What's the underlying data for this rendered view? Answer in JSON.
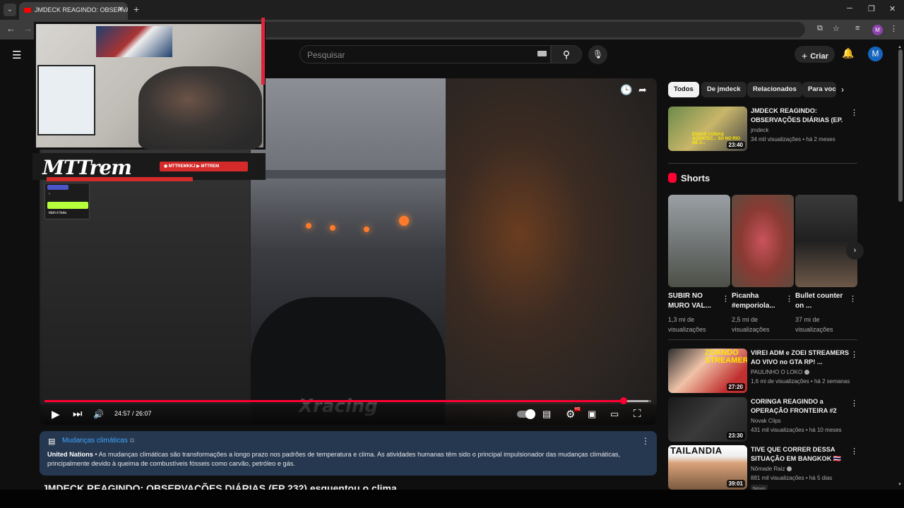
{
  "browser": {
    "tab_title": "JMDECK REAGINDO: OBSERVAÇ",
    "tab_close": "✕",
    "new_tab": "+",
    "tab_list": "⌄",
    "window_minimize": "─",
    "window_restore": "❐",
    "window_close": "✕",
    "profile_initial": "M",
    "nav_back": "←",
    "nav_forward": "→"
  },
  "header": {
    "search_placeholder": "Pesquisar",
    "create_label": "Criar",
    "create_plus": "+",
    "avatar_initial": "M"
  },
  "player": {
    "overlay": {
      "brand_name": "MTTrem",
      "social_handles": "◉ MTTREMKKJ  ▶ MTTREM",
      "chat_line": "tdah é foda",
      "watermark": "Xracing"
    },
    "time_display": "24:57 / 26:07",
    "progress_fraction": 0.955,
    "buffer_fraction": 0.995
  },
  "info_panel": {
    "link_label": "Mudanças climáticas",
    "source": "United Nations",
    "text": " • As mudanças climáticas são transformações a longo prazo nos padrões de temperatura e clima. As atividades humanas têm sido o principal impulsionador das mudanças climáticas, principalmente devido à queima de combustíveis fósseis como carvão, petróleo e gás."
  },
  "video_title": "JMDECK REAGINDO: OBSERVAÇÕES DIÁRIAS (EP 232) esquentou o clima",
  "chips": [
    "Todos",
    "De jmdeck",
    "Relacionados",
    "Para você"
  ],
  "recommendations": [
    {
      "title": "JMDECK REAGINDO: OBSERVAÇÕES DIÁRIAS (EP. ...",
      "channel": "jmdeck",
      "meta": "34 mil visualizações • há 2 meses",
      "duration": "23:40",
      "thumb_text": "ESSAS COISAS ACONTEC... SÓ NO RIO DE J..."
    },
    {
      "title": "VIREI ADM e ZOEI STREAMERS AO VIVO no GTA RP! ...",
      "channel": "PAULINHO O LOKO",
      "meta": "1,6 mi de visualizações • há 2 semanas",
      "duration": "27:20",
      "thumb_text": "ZOANDO STREAMERS"
    },
    {
      "title": "CORINGA REAGINDO a OPERAÇÃO FRONTEIRA #2",
      "channel": "Novak Clips",
      "meta": "431 mil visualizações • há 10 meses",
      "duration": "23:30",
      "thumb_text": ""
    },
    {
      "title": "TIVE QUE CORRER DESSA SITUAÇÃO EM BANGKOK 🇹🇭",
      "channel": "Nômade Raiz",
      "meta": "881 mil visualizações • há 5 dias",
      "duration": "39:01",
      "thumb_text": "TAILANDIA",
      "badge": "Novo"
    }
  ],
  "shorts": {
    "heading": "Shorts",
    "items": [
      {
        "title": "SUBIR NO MURO VAL...",
        "views": "1,3 mi de visualizações"
      },
      {
        "title": "Picanha #emporiola...",
        "views": "2,5 mi de visualizações"
      },
      {
        "title": "Bullet counter on ...",
        "views": "37 mi de visualizações"
      }
    ]
  },
  "colors": {
    "accent_red": "#ff0033",
    "link_blue": "#3ea6ff",
    "panel_bg": "#263850"
  }
}
